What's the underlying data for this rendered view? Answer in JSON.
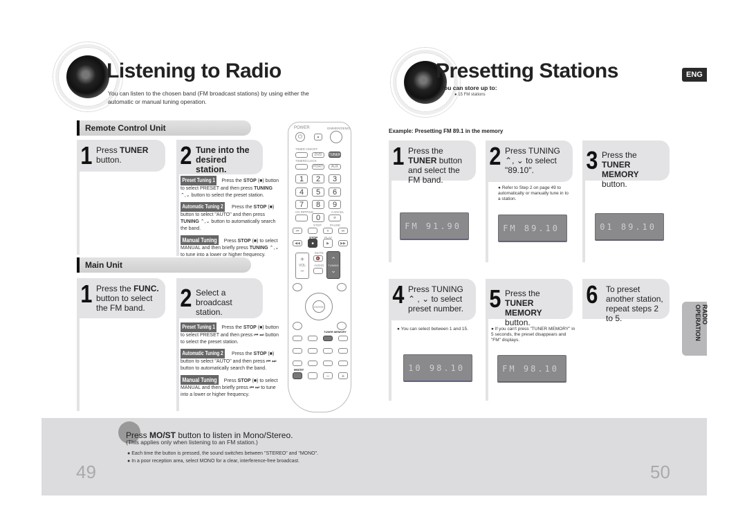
{
  "left_page": {
    "title": "Listening to Radio",
    "intro": "You can listen to the chosen band (FM broadcast stations) by using either the automatic or manual tuning operation.",
    "remote_section": {
      "heading": "Remote Control Unit",
      "step1": {
        "num": "1",
        "text_pre": "Press ",
        "bold": "TUNER",
        "text_post": " button."
      },
      "step2": {
        "num": "2",
        "text": "Tune into the desired station."
      },
      "notes": [
        {
          "tag": "Preset Tuning 1",
          "pre": "Press the ",
          "b1": "STOP",
          "mid": " (■) button to select PRESET and then press ",
          "b2": "TUNING",
          "post": " ⌃,⌄ button to select the preset station."
        },
        {
          "tag": "Automatic Tuning 2",
          "pre": "Press the ",
          "b1": "STOP",
          "mid": " (■) button to select \"AUTO\" and then press ",
          "b2": "TUNING",
          "post": " ⌃,⌄ button to automatically search the band."
        },
        {
          "tag": "Manual Tuning",
          "pre": "Press ",
          "b1": "STOP",
          "mid": " (■) to select MANUAL and then briefly press ",
          "b2": "TUNING",
          "post": " ⌃,⌄ to tune into a lower or higher frequency."
        }
      ]
    },
    "main_section": {
      "heading": "Main Unit",
      "step1": {
        "num": "1",
        "text_pre": "Press the ",
        "bold": "FUNC.",
        "text_post": " button to select the FM band."
      },
      "step2": {
        "num": "2",
        "text": "Select a broadcast station."
      },
      "notes": [
        {
          "tag": "Preset Tuning 1",
          "pre": "Press the ",
          "b1": "STOP",
          "mid": " (■) button to select PRESET and then press ",
          "b2": "",
          "post": "⏮ ⏭ button to select the preset station."
        },
        {
          "tag": "Automatic Tuning 2",
          "pre": "Press the ",
          "b1": "STOP",
          "mid": " (■) button to select \"AUTO\" and then press ",
          "b2": "",
          "post": "⏮ ⏭ button to automatically search the band."
        },
        {
          "tag": "Manual Tuning",
          "pre": "Press ",
          "b1": "STOP",
          "mid": " (■) to select MANUAL and then briefly press ",
          "b2": "",
          "post": "⏮ ⏭ to tune into a lower or higher frequency."
        }
      ]
    },
    "footer": {
      "heading_pre": "Press ",
      "heading_bold": "MO/ST",
      "heading_post": " button to listen in Mono/Stereo.",
      "sub": "(This applies only when listening to an FM station.)",
      "bullets": [
        "Each time the button is pressed, the sound switches between \"STEREO\" and \"MONO\".",
        "In a poor reception area, select MONO for a clear, interference-free broadcast."
      ],
      "page_number": "49"
    }
  },
  "remote": {
    "power": "POWER",
    "dimmer": "DIMMER/DEMO",
    "timer": "TIMER ON/OFF",
    "timer_clock": "TIMER/CLOCK",
    "dvd": "DVD",
    "tuner": "TUNER",
    "port": "PORT",
    "aux": "AUX",
    "digits": [
      "1",
      "2",
      "3",
      "4",
      "5",
      "6",
      "7",
      "8",
      "9",
      "0"
    ],
    "cd_ripping": "CD RIPPING",
    "cancel": "CANCEL",
    "step": "STEP",
    "pause": "PAUSE",
    "stop": "STOP",
    "play": "PLAY",
    "vol": "VOL",
    "mute": "MUTE",
    "audio": "AUDIO",
    "tuning": "TUNING",
    "enter": "ENTER",
    "tuner_memory": "TUNER MEMORY",
    "most": "MO/ST"
  },
  "right_page": {
    "title": "Presetting Stations",
    "store_heading": "You can store up to:",
    "store_item": "15 FM stations",
    "lang_badge": "ENG",
    "example": "Example: Presetting FM 89.1 in the memory",
    "steps": [
      {
        "num": "1",
        "html_pre": "Press the ",
        "bold": "TUNER",
        "post": " button  and select the FM band.",
        "note": "",
        "display": "FM  91.90"
      },
      {
        "num": "2",
        "html_pre": "Press TUNING ⌃, ⌄ to select \"89.10\".",
        "bold": "",
        "post": "",
        "note": "Refer to Step 2 on page 49 to automatically or manually tune in to a station.",
        "display": "FM  89.10"
      },
      {
        "num": "3",
        "html_pre": "Press the ",
        "bold": "TUNER MEMORY",
        "post": " button.",
        "note": "",
        "display": "01  89.10"
      },
      {
        "num": "4",
        "html_pre": "Press TUNING ⌃ , ⌄ to select preset number.",
        "bold": "",
        "post": "",
        "note": "You can select between 1 and 15.",
        "display": "10  98.10"
      },
      {
        "num": "5",
        "html_pre": "Press the ",
        "bold": "TUNER MEMORY",
        "post": " button.",
        "note": "If you can't press \"TUNER MEMORY\" in 5 seconds, the preset disappears and \"FM\" displays.",
        "display": "FM  98.10"
      },
      {
        "num": "6",
        "html_pre": "To preset another station, repeat steps 2 to 5.",
        "bold": "",
        "post": "",
        "note": "",
        "display": ""
      }
    ],
    "side_tab": "RADIO OPERATION",
    "page_number": "50"
  }
}
